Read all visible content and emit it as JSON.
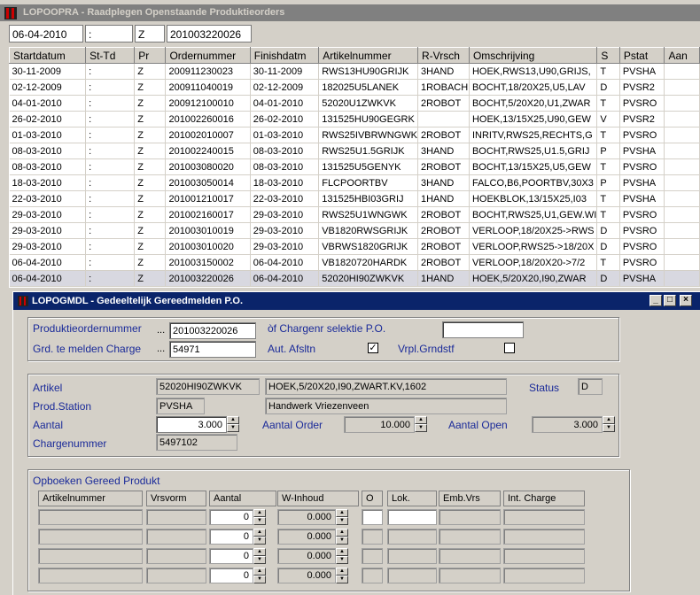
{
  "main_window": {
    "title": "LOPOOPRA - Raadplegen Openstaande Produktieorders",
    "filter": {
      "date": "06-04-2010",
      "colon": ":",
      "pr": "Z",
      "order": "201003220026"
    }
  },
  "grid": {
    "columns": [
      "Startdatum",
      "St-Td",
      "Pr",
      "Ordernummer",
      "Finishdatm",
      "Artikelnummer",
      "R-Vrsch",
      "Omschrijving",
      "S",
      "Pstat",
      "Aan"
    ],
    "rows": [
      [
        "30-11-2009",
        ":",
        "Z",
        "200911230023",
        "30-11-2009",
        "RWS13HU90GRIJK",
        "3HAND",
        "HOEK,RWS13,U90,GRIJS,",
        "T",
        "PVSHA"
      ],
      [
        "02-12-2009",
        ":",
        "Z",
        "200911040019",
        "02-12-2009",
        "182025U5LANEK",
        "1ROBACH",
        "BOCHT,18/20X25,U5,LAV",
        "D",
        "PVSR2"
      ],
      [
        "04-01-2010",
        ":",
        "Z",
        "200912100010",
        "04-01-2010",
        "52020U1ZWKVK",
        "2ROBOT",
        "BOCHT,5/20X20,U1,ZWAR",
        "T",
        "PVSRO"
      ],
      [
        "26-02-2010",
        ":",
        "Z",
        "201002260016",
        "26-02-2010",
        "131525HU90GEGRK",
        "",
        "HOEK,13/15X25,U90,GEW",
        "V",
        "PVSR2"
      ],
      [
        "01-03-2010",
        ":",
        "Z",
        "201002010007",
        "01-03-2010",
        "RWS25IVBRWNGWK",
        "2ROBOT",
        "INRITV,RWS25,RECHTS,G",
        "T",
        "PVSRO"
      ],
      [
        "08-03-2010",
        ":",
        "Z",
        "201002240015",
        "08-03-2010",
        "RWS25U1.5GRIJK",
        "3HAND",
        "BOCHT,RWS25,U1.5,GRIJ",
        "P",
        "PVSHA"
      ],
      [
        "08-03-2010",
        ":",
        "Z",
        "201003080020",
        "08-03-2010",
        "131525U5GENYK",
        "2ROBOT",
        "BOCHT,13/15X25,U5,GEW",
        "T",
        "PVSRO"
      ],
      [
        "18-03-2010",
        ":",
        "Z",
        "201003050014",
        "18-03-2010",
        "FLCPOORTBV",
        "3HAND",
        "FALCO,B6,POORTBV,30X3",
        "P",
        "PVSHA"
      ],
      [
        "22-03-2010",
        ":",
        "Z",
        "201001210017",
        "22-03-2010",
        "131525HBI03GRIJ",
        "1HAND",
        "HOEKBLOK,13/15X25,I03",
        "T",
        "PVSHA"
      ],
      [
        "29-03-2010",
        ":",
        "Z",
        "201002160017",
        "29-03-2010",
        "RWS25U1WNGWK",
        "2ROBOT",
        "BOCHT,RWS25,U1,GEW.WI",
        "T",
        "PVSRO"
      ],
      [
        "29-03-2010",
        ":",
        "Z",
        "201003010019",
        "29-03-2010",
        "VB1820RWSGRIJK",
        "2ROBOT",
        "VERLOOP,18/20X25->RWS",
        "D",
        "PVSRO"
      ],
      [
        "29-03-2010",
        ":",
        "Z",
        "201003010020",
        "29-03-2010",
        "VBRWS1820GRIJK",
        "2ROBOT",
        "VERLOOP,RWS25->18/20X",
        "D",
        "PVSRO"
      ],
      [
        "06-04-2010",
        ":",
        "Z",
        "201003150002",
        "06-04-2010",
        "VB1820720HARDK",
        "2ROBOT",
        "VERLOOP,18/20X20->7/2",
        "T",
        "PVSRO"
      ],
      [
        "06-04-2010",
        ":",
        "Z",
        "201003220026",
        "06-04-2010",
        "52020HI90ZWKVK",
        "1HAND",
        "HOEK,5/20X20,I90,ZWAR",
        "D",
        "PVSHA"
      ]
    ]
  },
  "dialog": {
    "title": "LOPOGMDL - Gedeeltelijk Gereedmelden P.O.",
    "prod_order_label": "Produktieordernummer",
    "prod_order_value": "201003220026",
    "charge_label": "Grd. te melden Charge",
    "charge_value": "54971",
    "of_charge_label": "òf Chargenr selektie P.O.",
    "of_charge_value": "",
    "aut_afsltn_label": "Aut. Afsltn",
    "aut_afsltn_checked": "✓",
    "vrpl_label": "Vrpl.Grndstf",
    "dots": "...",
    "artikel_label": "Artikel",
    "artikel_code": "52020HI90ZWKVK",
    "artikel_desc": "HOEK,5/20X20,I90,ZWART.KV,1602",
    "status_label": "Status",
    "status_value": "D",
    "station_label": "Prod.Station",
    "station_code": "PVSHA",
    "station_desc": "Handwerk Vriezenveen",
    "aantal_label": "Aantal",
    "aantal_value": "3.000",
    "aantal_order_label": "Aantal Order",
    "aantal_order_value": "10.000",
    "aantal_open_label": "Aantal Open",
    "aantal_open_value": "3.000",
    "chargenr_label": "Chargenummer",
    "chargenr_value": "5497102",
    "opboeken_label": "Opboeken Gereed Produkt",
    "op_columns": [
      "Artikelnummer",
      "Vrsvorm",
      "Aantal",
      "W-Inhoud",
      "O",
      "Lok.",
      "Emb.Vrs",
      "Int. Charge"
    ],
    "op_rows": [
      {
        "aantal": "0",
        "winhoud": "0.000"
      },
      {
        "aantal": "0",
        "winhoud": "0.000"
      },
      {
        "aantal": "0",
        "winhoud": "0.000"
      },
      {
        "aantal": "0",
        "winhoud": "0.000"
      }
    ]
  },
  "colors": {
    "dialog_title": "#0a246a",
    "label_blue": "#1a2a99",
    "window_title_inactive": "#808080"
  }
}
